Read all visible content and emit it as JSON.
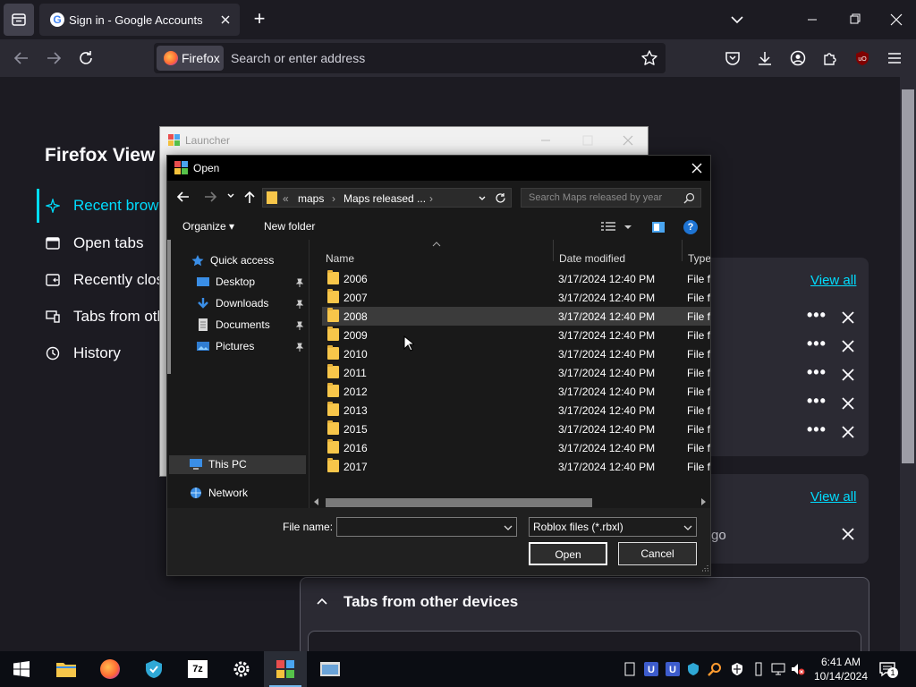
{
  "browser": {
    "tab_title": "Sign in - Google Accounts",
    "tab_favicon": "G",
    "firefox_badge": "Firefox",
    "address_placeholder": "Search or enter address",
    "new_tab_symbol": "+"
  },
  "firefox_view": {
    "title": "Firefox View",
    "nav": [
      {
        "label": "Recent brows",
        "icon": "sparkle-icon"
      },
      {
        "label": "Open tabs",
        "icon": "tabs-icon"
      },
      {
        "label": "Recently clos",
        "icon": "closed-tabs-icon"
      },
      {
        "label": "Tabs from oth",
        "icon": "devices-icon"
      },
      {
        "label": "History",
        "icon": "history-icon"
      }
    ],
    "view_all_1": "View all",
    "view_all_2": "View all",
    "ago_fragment": "go",
    "tabs_other_devices": "Tabs from other devices",
    "dots": "•••"
  },
  "launcher": {
    "title": "Launcher"
  },
  "dialog": {
    "title": "Open",
    "breadcrumb": {
      "prefix": "«",
      "items": [
        "maps",
        "Maps released ..."
      ]
    },
    "search_placeholder": "Search Maps released by year",
    "organize": "Organize",
    "new_folder": "New folder",
    "help": "?",
    "nav_pane": {
      "quick_access": "Quick access",
      "items": [
        "Desktop",
        "Downloads",
        "Documents",
        "Pictures"
      ],
      "this_pc": "This PC",
      "network": "Network"
    },
    "columns": {
      "name": "Name",
      "date": "Date modified",
      "type": "Type"
    },
    "files": [
      {
        "name": "2006",
        "date": "3/17/2024 12:40 PM",
        "type": "File fo"
      },
      {
        "name": "2007",
        "date": "3/17/2024 12:40 PM",
        "type": "File fo"
      },
      {
        "name": "2008",
        "date": "3/17/2024 12:40 PM",
        "type": "File fo",
        "selected": true
      },
      {
        "name": "2009",
        "date": "3/17/2024 12:40 PM",
        "type": "File fo"
      },
      {
        "name": "2010",
        "date": "3/17/2024 12:40 PM",
        "type": "File fo"
      },
      {
        "name": "2011",
        "date": "3/17/2024 12:40 PM",
        "type": "File fo"
      },
      {
        "name": "2012",
        "date": "3/17/2024 12:40 PM",
        "type": "File fo"
      },
      {
        "name": "2013",
        "date": "3/17/2024 12:40 PM",
        "type": "File fo"
      },
      {
        "name": "2015",
        "date": "3/17/2024 12:40 PM",
        "type": "File fo"
      },
      {
        "name": "2016",
        "date": "3/17/2024 12:40 PM",
        "type": "File fo"
      },
      {
        "name": "2017",
        "date": "3/17/2024 12:40 PM",
        "type": "File fo"
      }
    ],
    "file_name_label": "File name:",
    "file_name_value": "",
    "file_type": "Roblox files (*.rbxl)",
    "open_button": "Open",
    "cancel_button": "Cancel"
  },
  "taskbar": {
    "time": "6:41 AM",
    "date": "10/14/2024",
    "notification_count": "1",
    "apps": [
      "windows-start-icon",
      "file-explorer-icon",
      "firefox-icon",
      "shield-app-icon",
      "7zip-icon",
      "settings-icon",
      "roblox-studio-icon",
      "launcher-app-icon"
    ],
    "seven_zip_label": "7z"
  },
  "colors": {
    "accent": "#00ddff",
    "folder": "#f7c64a",
    "page_bg": "#1c1b22",
    "card_bg": "#2b2a33"
  }
}
